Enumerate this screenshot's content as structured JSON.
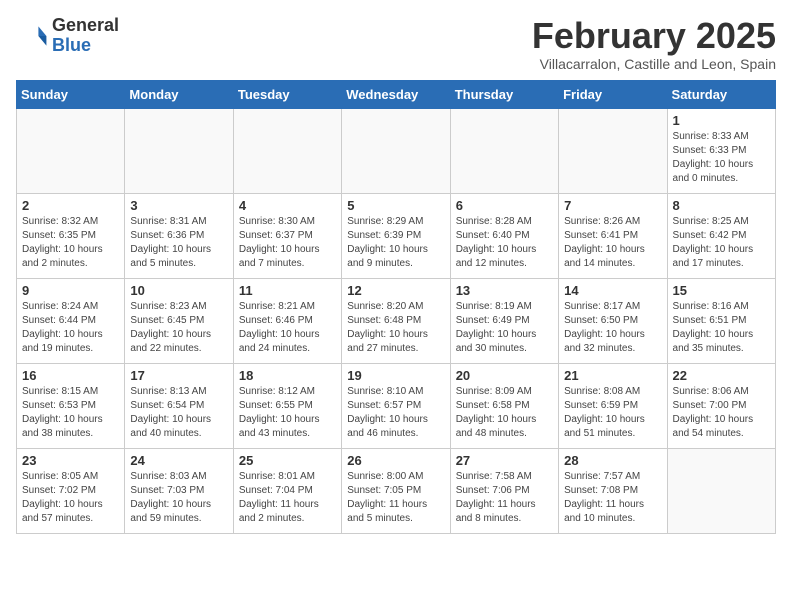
{
  "header": {
    "logo_general": "General",
    "logo_blue": "Blue",
    "month": "February 2025",
    "location": "Villacarralon, Castille and Leon, Spain"
  },
  "weekdays": [
    "Sunday",
    "Monday",
    "Tuesday",
    "Wednesday",
    "Thursday",
    "Friday",
    "Saturday"
  ],
  "weeks": [
    [
      {
        "day": "",
        "info": ""
      },
      {
        "day": "",
        "info": ""
      },
      {
        "day": "",
        "info": ""
      },
      {
        "day": "",
        "info": ""
      },
      {
        "day": "",
        "info": ""
      },
      {
        "day": "",
        "info": ""
      },
      {
        "day": "1",
        "info": "Sunrise: 8:33 AM\nSunset: 6:33 PM\nDaylight: 10 hours\nand 0 minutes."
      }
    ],
    [
      {
        "day": "2",
        "info": "Sunrise: 8:32 AM\nSunset: 6:35 PM\nDaylight: 10 hours\nand 2 minutes."
      },
      {
        "day": "3",
        "info": "Sunrise: 8:31 AM\nSunset: 6:36 PM\nDaylight: 10 hours\nand 5 minutes."
      },
      {
        "day": "4",
        "info": "Sunrise: 8:30 AM\nSunset: 6:37 PM\nDaylight: 10 hours\nand 7 minutes."
      },
      {
        "day": "5",
        "info": "Sunrise: 8:29 AM\nSunset: 6:39 PM\nDaylight: 10 hours\nand 9 minutes."
      },
      {
        "day": "6",
        "info": "Sunrise: 8:28 AM\nSunset: 6:40 PM\nDaylight: 10 hours\nand 12 minutes."
      },
      {
        "day": "7",
        "info": "Sunrise: 8:26 AM\nSunset: 6:41 PM\nDaylight: 10 hours\nand 14 minutes."
      },
      {
        "day": "8",
        "info": "Sunrise: 8:25 AM\nSunset: 6:42 PM\nDaylight: 10 hours\nand 17 minutes."
      }
    ],
    [
      {
        "day": "9",
        "info": "Sunrise: 8:24 AM\nSunset: 6:44 PM\nDaylight: 10 hours\nand 19 minutes."
      },
      {
        "day": "10",
        "info": "Sunrise: 8:23 AM\nSunset: 6:45 PM\nDaylight: 10 hours\nand 22 minutes."
      },
      {
        "day": "11",
        "info": "Sunrise: 8:21 AM\nSunset: 6:46 PM\nDaylight: 10 hours\nand 24 minutes."
      },
      {
        "day": "12",
        "info": "Sunrise: 8:20 AM\nSunset: 6:48 PM\nDaylight: 10 hours\nand 27 minutes."
      },
      {
        "day": "13",
        "info": "Sunrise: 8:19 AM\nSunset: 6:49 PM\nDaylight: 10 hours\nand 30 minutes."
      },
      {
        "day": "14",
        "info": "Sunrise: 8:17 AM\nSunset: 6:50 PM\nDaylight: 10 hours\nand 32 minutes."
      },
      {
        "day": "15",
        "info": "Sunrise: 8:16 AM\nSunset: 6:51 PM\nDaylight: 10 hours\nand 35 minutes."
      }
    ],
    [
      {
        "day": "16",
        "info": "Sunrise: 8:15 AM\nSunset: 6:53 PM\nDaylight: 10 hours\nand 38 minutes."
      },
      {
        "day": "17",
        "info": "Sunrise: 8:13 AM\nSunset: 6:54 PM\nDaylight: 10 hours\nand 40 minutes."
      },
      {
        "day": "18",
        "info": "Sunrise: 8:12 AM\nSunset: 6:55 PM\nDaylight: 10 hours\nand 43 minutes."
      },
      {
        "day": "19",
        "info": "Sunrise: 8:10 AM\nSunset: 6:57 PM\nDaylight: 10 hours\nand 46 minutes."
      },
      {
        "day": "20",
        "info": "Sunrise: 8:09 AM\nSunset: 6:58 PM\nDaylight: 10 hours\nand 48 minutes."
      },
      {
        "day": "21",
        "info": "Sunrise: 8:08 AM\nSunset: 6:59 PM\nDaylight: 10 hours\nand 51 minutes."
      },
      {
        "day": "22",
        "info": "Sunrise: 8:06 AM\nSunset: 7:00 PM\nDaylight: 10 hours\nand 54 minutes."
      }
    ],
    [
      {
        "day": "23",
        "info": "Sunrise: 8:05 AM\nSunset: 7:02 PM\nDaylight: 10 hours\nand 57 minutes."
      },
      {
        "day": "24",
        "info": "Sunrise: 8:03 AM\nSunset: 7:03 PM\nDaylight: 10 hours\nand 59 minutes."
      },
      {
        "day": "25",
        "info": "Sunrise: 8:01 AM\nSunset: 7:04 PM\nDaylight: 11 hours\nand 2 minutes."
      },
      {
        "day": "26",
        "info": "Sunrise: 8:00 AM\nSunset: 7:05 PM\nDaylight: 11 hours\nand 5 minutes."
      },
      {
        "day": "27",
        "info": "Sunrise: 7:58 AM\nSunset: 7:06 PM\nDaylight: 11 hours\nand 8 minutes."
      },
      {
        "day": "28",
        "info": "Sunrise: 7:57 AM\nSunset: 7:08 PM\nDaylight: 11 hours\nand 10 minutes."
      },
      {
        "day": "",
        "info": ""
      }
    ]
  ]
}
